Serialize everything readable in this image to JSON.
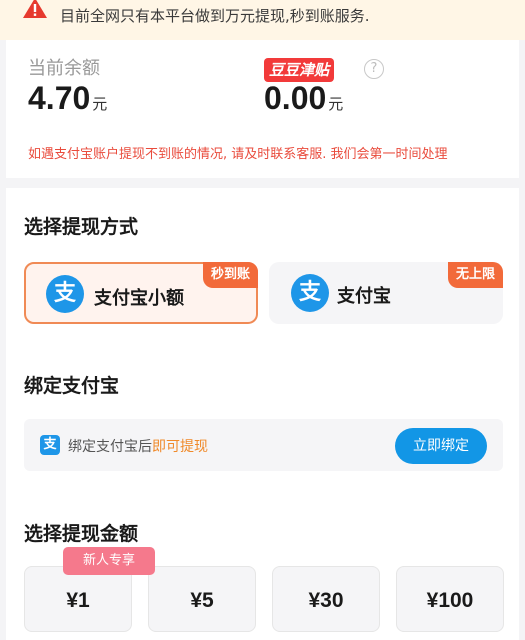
{
  "notice": {
    "icon": "warning-icon",
    "text": "目前全网只有本平台做到万元提现,秒到账服务."
  },
  "balance": {
    "label": "当前余额",
    "value": "4.70",
    "unit": "元",
    "bean_badge": "豆豆津贴",
    "bean_value": "0.00",
    "bean_unit": "元",
    "help_glyph": "?",
    "note": "如遇支付宝账户提现不到账的情况, 请及时联系客服. 我们会第一时间处理"
  },
  "methods": {
    "title": "选择提现方式",
    "items": [
      {
        "label": "支付宝小额",
        "badge": "秒到账",
        "icon_glyph": "支",
        "selected": true
      },
      {
        "label": "支付宝",
        "badge": "无上限",
        "icon_glyph": "支",
        "selected": false
      }
    ]
  },
  "bind": {
    "title": "绑定支付宝",
    "icon_glyph": "支",
    "text_prefix": "绑定支付宝后",
    "text_highlight": "即可提现",
    "button_label": "立即绑定"
  },
  "amounts": {
    "title": "选择提现金额",
    "new_user_tag": "新人专享",
    "items": [
      "¥1",
      "¥5",
      "¥30",
      "¥100"
    ]
  },
  "colors": {
    "accent_orange": "#f26a3a",
    "alipay_blue": "#1e96e8",
    "note_red": "#e94b3c",
    "highlight_orange": "#f08a2a"
  }
}
